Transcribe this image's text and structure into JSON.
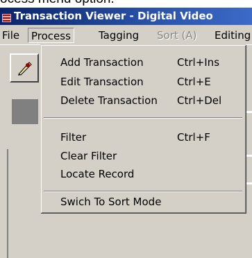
{
  "caption": "ocess menu option.",
  "window": {
    "title": "Transaction Viewer - Digital Video"
  },
  "menubar": {
    "items": [
      {
        "label": "File"
      },
      {
        "label": "Process"
      },
      {
        "label": "Tagging"
      },
      {
        "label": "Sort (A)"
      },
      {
        "label": "Editing"
      }
    ]
  },
  "process_menu": {
    "items": [
      {
        "label": "Add Transaction",
        "shortcut": "Ctrl+Ins"
      },
      {
        "label": "Edit Transaction",
        "shortcut": "Ctrl+E"
      },
      {
        "label": "Delete Transaction",
        "shortcut": "Ctrl+Del"
      },
      {
        "label": "Filter",
        "shortcut": "Ctrl+F"
      },
      {
        "label": "Clear Filter",
        "shortcut": ""
      },
      {
        "label": "Locate Record",
        "shortcut": ""
      },
      {
        "label": "Swich To Sort Mode",
        "shortcut": ""
      }
    ]
  },
  "colors": {
    "title_bar": "#0a246a",
    "menu_bg": "#d4d0c8",
    "disabled_text": "#8a877f"
  }
}
